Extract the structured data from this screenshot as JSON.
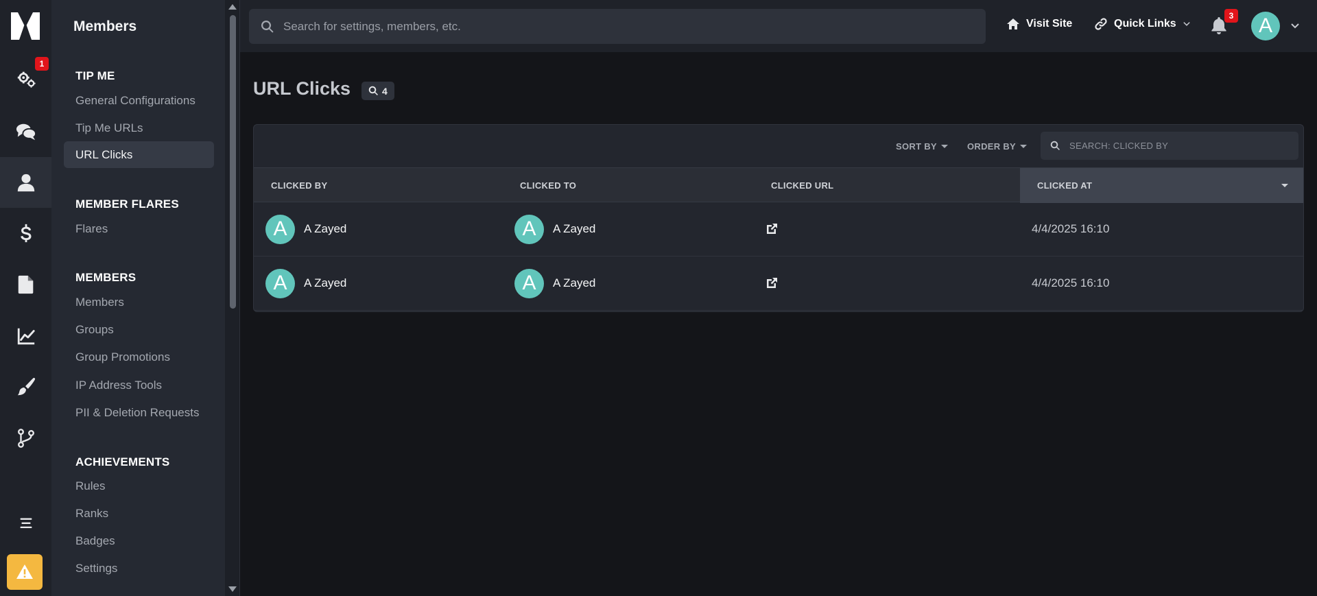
{
  "rail": {
    "settings_badge": "1"
  },
  "sidebar": {
    "title": "Members",
    "sections": [
      {
        "heading": "TIP ME",
        "items": [
          "General Configurations",
          "Tip Me URLs",
          "URL Clicks"
        ]
      },
      {
        "heading": "MEMBER FLARES",
        "items": [
          "Flares"
        ]
      },
      {
        "heading": "MEMBERS",
        "items": [
          "Members",
          "Groups",
          "Group Promotions",
          "IP Address Tools",
          "PII & Deletion Requests"
        ]
      },
      {
        "heading": "ACHIEVEMENTS",
        "items": [
          "Rules",
          "Ranks",
          "Badges",
          "Settings"
        ]
      }
    ],
    "active_item": "URL Clicks"
  },
  "topbar": {
    "search_placeholder": "Search for settings, members, etc.",
    "visit_site": "Visit Site",
    "quick_links": "Quick Links",
    "notification_count": "3",
    "avatar_letter": "A"
  },
  "page": {
    "title": "URL Clicks",
    "count": "4"
  },
  "table": {
    "sort_by": "SORT BY",
    "order_by": "ORDER BY",
    "search_placeholder": "SEARCH: CLICKED BY",
    "columns": [
      "CLICKED BY",
      "CLICKED TO",
      "CLICKED URL",
      "CLICKED AT"
    ],
    "rows": [
      {
        "clicked_by": "A Zayed",
        "clicked_by_initial": "A",
        "clicked_to": "A Zayed",
        "clicked_to_initial": "A",
        "clicked_at": "4/4/2025 16:10"
      },
      {
        "clicked_by": "A Zayed",
        "clicked_by_initial": "A",
        "clicked_to": "A Zayed",
        "clicked_to_initial": "A",
        "clicked_at": "4/4/2025 16:10"
      }
    ]
  },
  "colors": {
    "accent_avatar": "#61c5bb",
    "badge_red": "#e1151b",
    "warning_yellow": "#f4b840"
  }
}
